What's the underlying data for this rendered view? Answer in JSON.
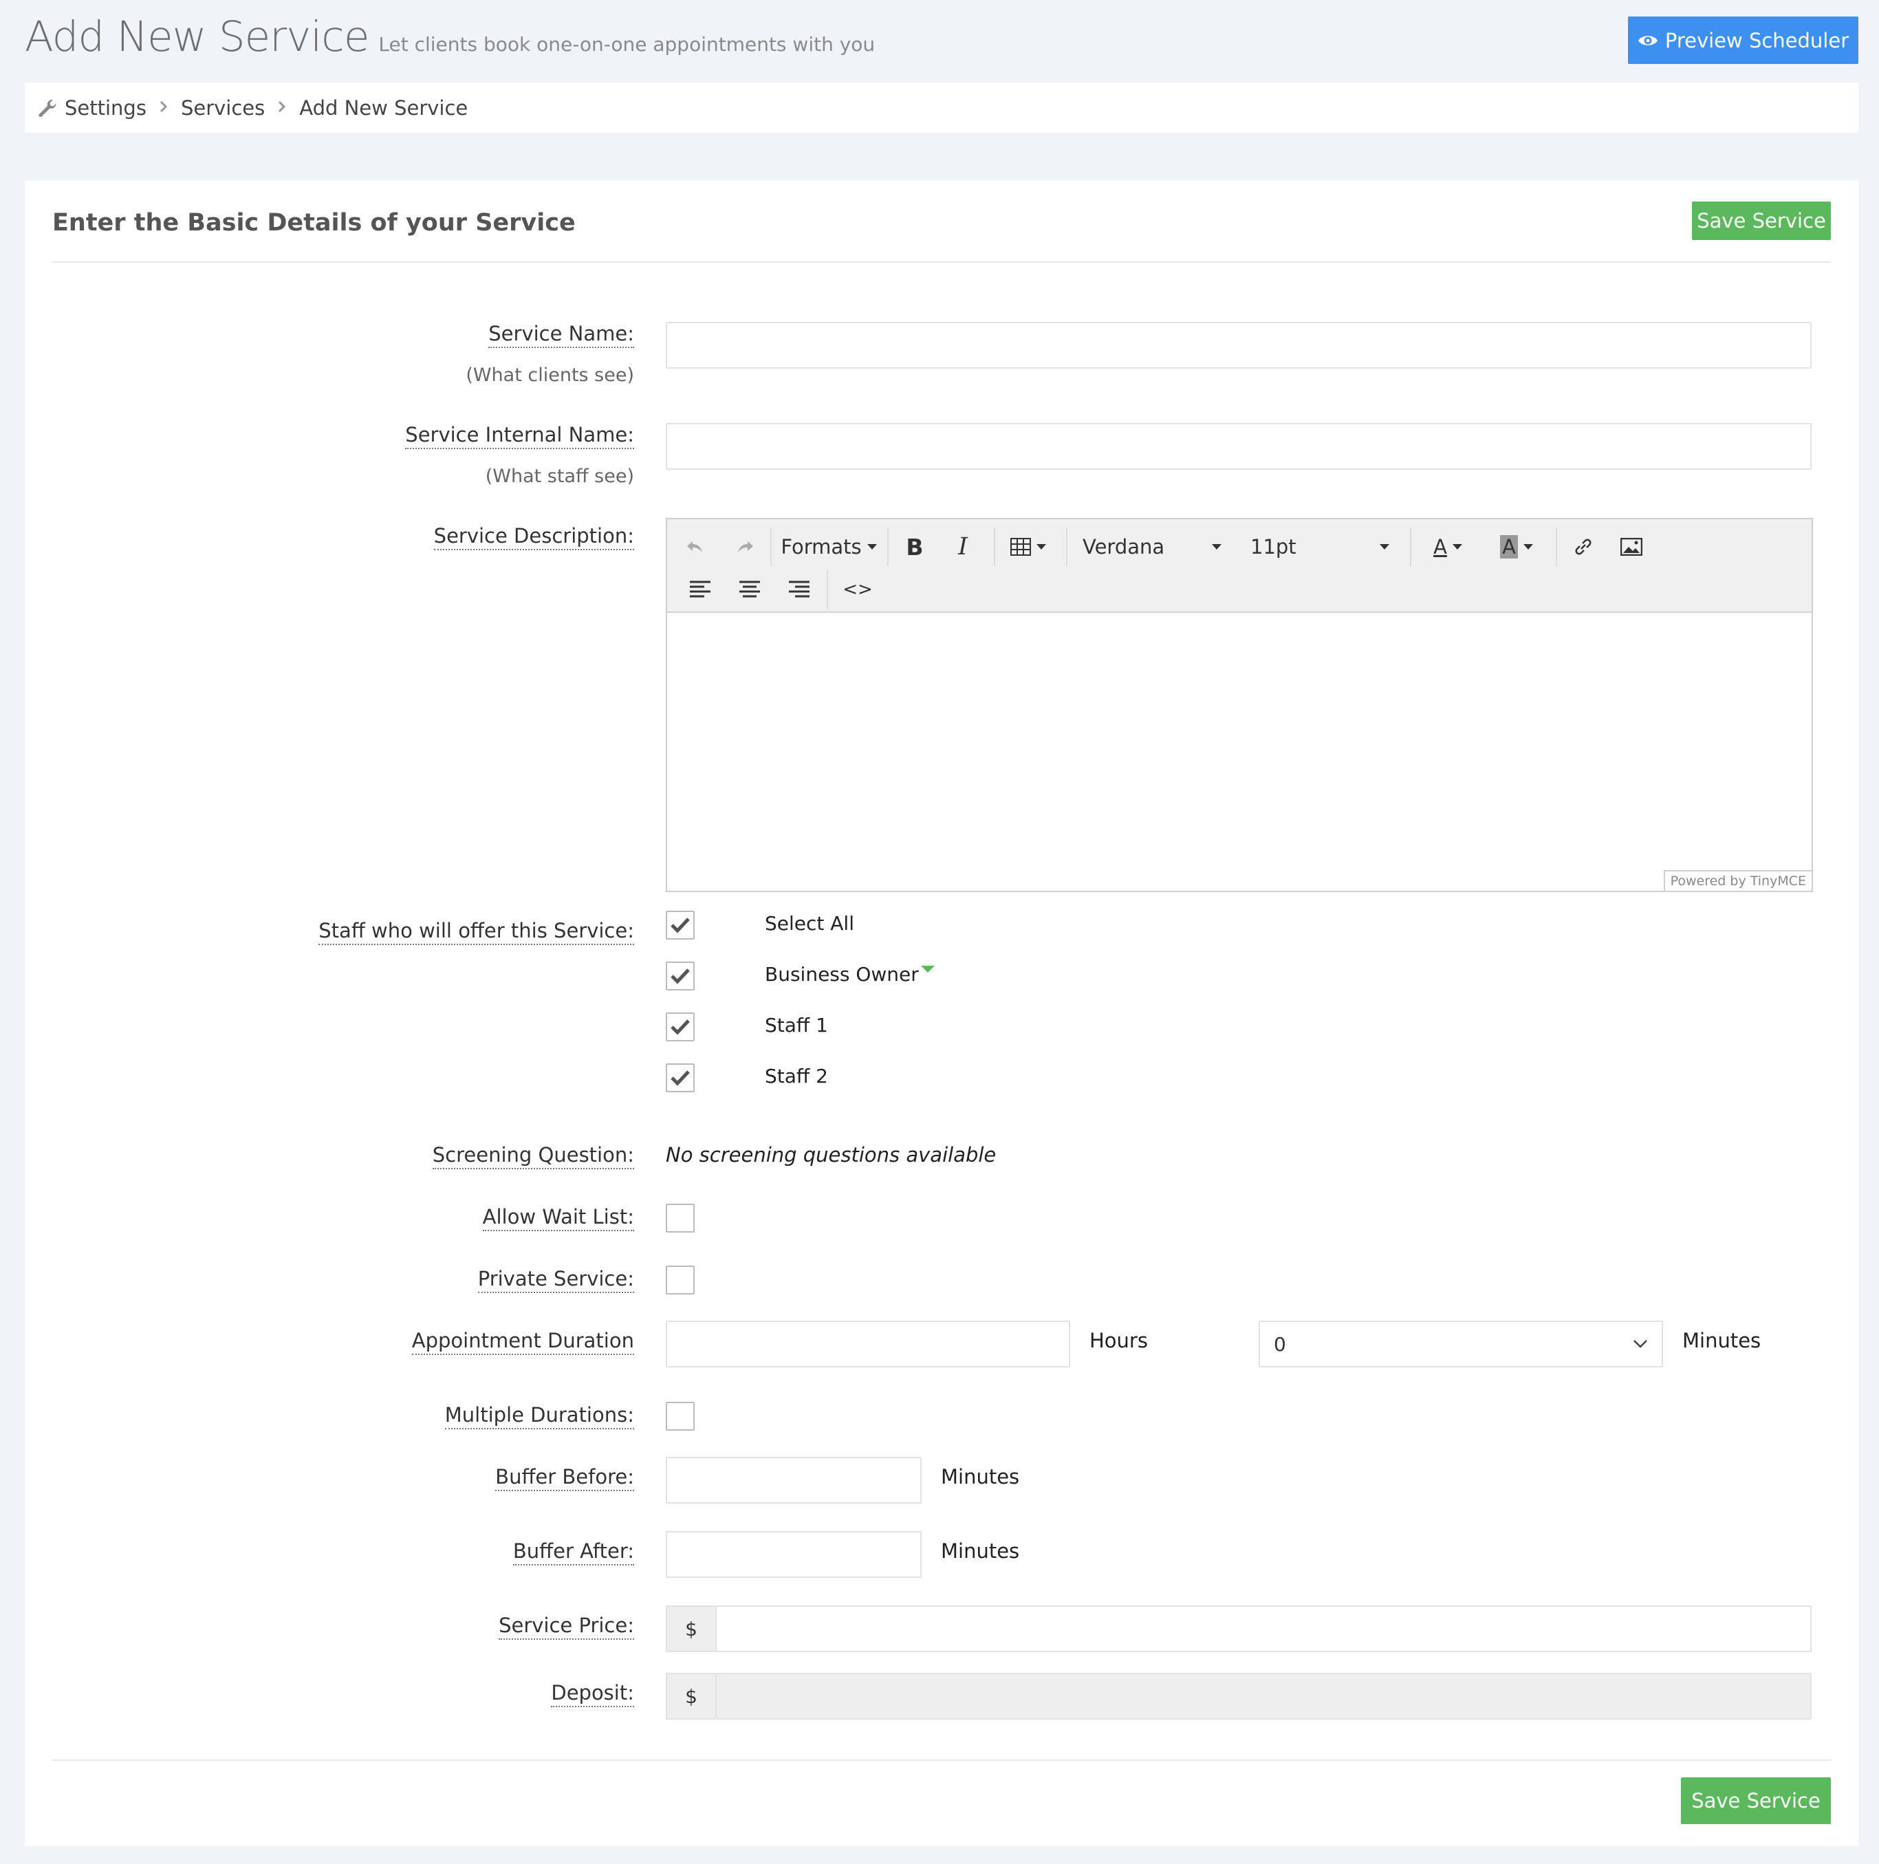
{
  "header": {
    "title": "Add New Service",
    "subtitle": "Let clients book one-on-one appointments with you",
    "preview_button": "Preview Scheduler"
  },
  "breadcrumb": {
    "items": [
      "Settings",
      "Services",
      "Add New Service"
    ]
  },
  "panel": {
    "title": "Enter the Basic Details of your Service",
    "save_button": "Save Service"
  },
  "form": {
    "service_name": {
      "label": "Service Name:",
      "hint": "(What clients see)",
      "value": ""
    },
    "internal_name": {
      "label": "Service Internal Name:",
      "hint": "(What staff see)",
      "value": ""
    },
    "description": {
      "label": "Service Description:",
      "toolbar": {
        "formats": "Formats",
        "font": "Verdana",
        "size": "11pt",
        "bold": "B",
        "italic": "I",
        "text_color": "A",
        "bg_color": "A",
        "code": "<>"
      },
      "powered_by": "Powered by TinyMCE"
    },
    "staff": {
      "label": "Staff who will offer this Service:",
      "options": [
        {
          "label": "Select All",
          "checked": true
        },
        {
          "label": "Business Owner",
          "checked": true
        },
        {
          "label": "Staff 1",
          "checked": true
        },
        {
          "label": "Staff 2",
          "checked": true
        }
      ]
    },
    "screening": {
      "label": "Screening Question:",
      "value": "No screening questions available"
    },
    "wait_list": {
      "label": "Allow Wait List:",
      "checked": false
    },
    "private": {
      "label": "Private Service:",
      "checked": false
    },
    "duration": {
      "label": "Appointment Duration",
      "hours_value": "",
      "hours_unit": "Hours",
      "minutes_value": "0",
      "minutes_unit": "Minutes"
    },
    "multiple_durations": {
      "label": "Multiple Durations:",
      "checked": false
    },
    "buffer_before": {
      "label": "Buffer Before:",
      "value": "",
      "unit": "Minutes"
    },
    "buffer_after": {
      "label": "Buffer After:",
      "value": "",
      "unit": "Minutes"
    },
    "price": {
      "label": "Service Price:",
      "currency": "$",
      "value": ""
    },
    "deposit": {
      "label": "Deposit:",
      "currency": "$",
      "value": ""
    }
  },
  "colors": {
    "primary": "#3d8ff0",
    "success": "#5cb85c",
    "background": "#f0f3f7"
  }
}
